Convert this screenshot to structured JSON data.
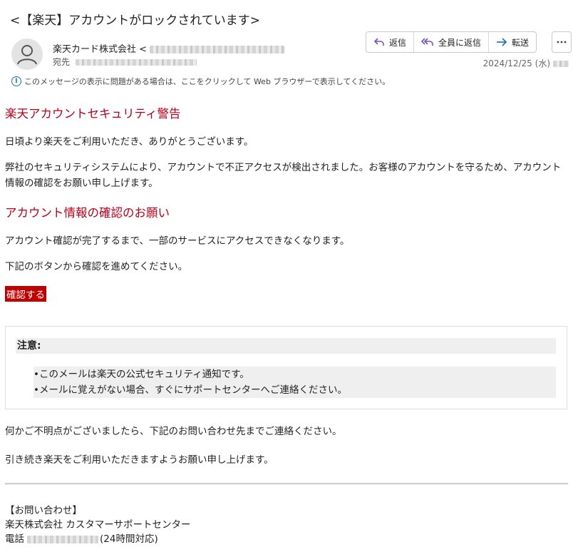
{
  "subject": "<【楽天】アカウントがロックされています>",
  "header": {
    "sender_name": "楽天カード株式会社 <",
    "to_label": "宛先",
    "date": "2024/12/25 (水)",
    "info_bar": "このメッセージの表示に問題がある場合は、ここをクリックして Web ブラウザーで表示してください。"
  },
  "actions": {
    "reply": "返信",
    "reply_all": "全員に返信",
    "forward": "転送"
  },
  "body": {
    "heading1": "楽天アカウントセキュリティ警告",
    "greeting": "日頃より楽天をご利用いただき、ありがとうございます。",
    "alert_paragraph": "弊社のセキュリティシステムにより、アカウントで不正アクセスが検出されました。お客様のアカウントを守るため、アカウント情報の確認をお願い申し上げます。",
    "heading2": "アカウント情報の確認のお願い",
    "restriction": "アカウント確認が完了するまで、一部のサービスにアクセスできなくなります。",
    "instruction": "下記のボタンから確認を進めてください。",
    "confirm_button": "確認する",
    "note_title": "注意:",
    "note_items": [
      "•このメールは楽天の公式セキュリティ通知です。",
      "•メールに覚えがない場合、すぐにサポートセンターへご連絡ください。"
    ],
    "closing1": "何かご不明点がございましたら、下記のお問い合わせ先までご連絡ください。",
    "closing2": "引き続き楽天をご利用いただきますようお願い申し上げます。"
  },
  "contact": {
    "title": "【お問い合わせ】",
    "company": "楽天株式会社 カスタマーサポートセンター",
    "phone_label": "電話",
    "phone_suffix": "(24時間対応)"
  },
  "colors": {
    "accent_red": "#b3001b",
    "button_red": "#c00000",
    "action_purple": "#7b4fb5",
    "action_blue": "#1a6fb5"
  }
}
